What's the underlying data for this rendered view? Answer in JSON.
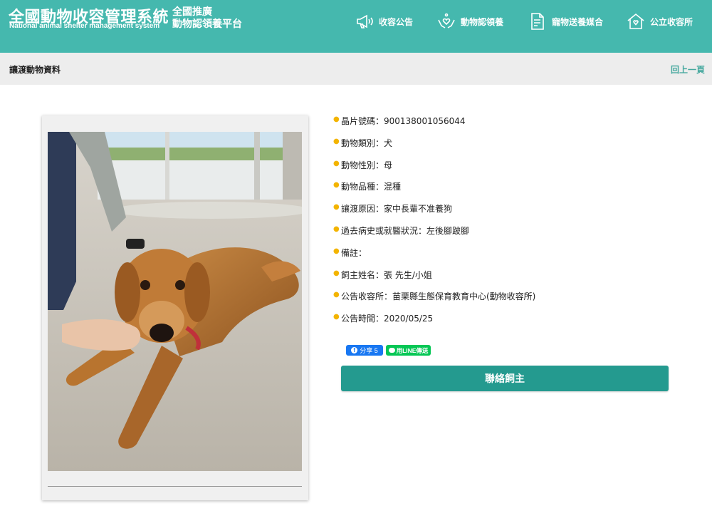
{
  "header": {
    "title": "全國動物收容管理系統",
    "subtitle": "National animal shelter management system",
    "side_line1": "全國推廣",
    "side_line2": "動物認領養平台",
    "nav": [
      {
        "label": "收容公告",
        "icon": "megaphone-icon"
      },
      {
        "label": "動物認領養",
        "icon": "adopt-hands-icon"
      },
      {
        "label": "寵物送養媒合",
        "icon": "document-icon"
      },
      {
        "label": "公立收容所",
        "icon": "shelter-house-icon"
      }
    ]
  },
  "subbar": {
    "title": "讓渡動物資料",
    "back": "回上一頁"
  },
  "details": [
    "晶片號碼：900138001056044",
    "動物類別：犬",
    "動物性別：母",
    "動物品種：混種",
    "讓渡原因：家中長輩不准養狗",
    "過去病史或就醫狀況：左後腳跛腳",
    "備註：",
    "飼主姓名：張 先生/小姐",
    "公告收容所：苗栗縣生態保育教育中心(動物收容所)",
    "公告時間：2020/05/25"
  ],
  "share": {
    "facebook": "分享 5",
    "line": "用LINE傳送"
  },
  "contact_button": "聯絡飼主",
  "colors": {
    "header": "#45b8ae",
    "button": "#249a8f",
    "bullet": "#f3b400",
    "subbar": "#ededed"
  }
}
